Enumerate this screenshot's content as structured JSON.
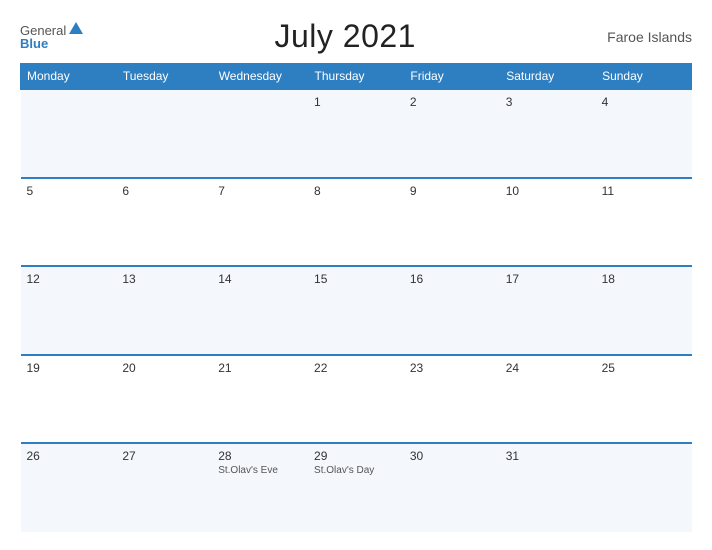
{
  "header": {
    "logo_general": "General",
    "logo_blue": "Blue",
    "title": "July 2021",
    "region": "Faroe Islands"
  },
  "columns": [
    "Monday",
    "Tuesday",
    "Wednesday",
    "Thursday",
    "Friday",
    "Saturday",
    "Sunday"
  ],
  "weeks": [
    [
      {
        "day": "",
        "event": ""
      },
      {
        "day": "",
        "event": ""
      },
      {
        "day": "",
        "event": ""
      },
      {
        "day": "1",
        "event": ""
      },
      {
        "day": "2",
        "event": ""
      },
      {
        "day": "3",
        "event": ""
      },
      {
        "day": "4",
        "event": ""
      }
    ],
    [
      {
        "day": "5",
        "event": ""
      },
      {
        "day": "6",
        "event": ""
      },
      {
        "day": "7",
        "event": ""
      },
      {
        "day": "8",
        "event": ""
      },
      {
        "day": "9",
        "event": ""
      },
      {
        "day": "10",
        "event": ""
      },
      {
        "day": "11",
        "event": ""
      }
    ],
    [
      {
        "day": "12",
        "event": ""
      },
      {
        "day": "13",
        "event": ""
      },
      {
        "day": "14",
        "event": ""
      },
      {
        "day": "15",
        "event": ""
      },
      {
        "day": "16",
        "event": ""
      },
      {
        "day": "17",
        "event": ""
      },
      {
        "day": "18",
        "event": ""
      }
    ],
    [
      {
        "day": "19",
        "event": ""
      },
      {
        "day": "20",
        "event": ""
      },
      {
        "day": "21",
        "event": ""
      },
      {
        "day": "22",
        "event": ""
      },
      {
        "day": "23",
        "event": ""
      },
      {
        "day": "24",
        "event": ""
      },
      {
        "day": "25",
        "event": ""
      }
    ],
    [
      {
        "day": "26",
        "event": ""
      },
      {
        "day": "27",
        "event": ""
      },
      {
        "day": "28",
        "event": "St.Olav's Eve"
      },
      {
        "day": "29",
        "event": "St.Olav's Day"
      },
      {
        "day": "30",
        "event": ""
      },
      {
        "day": "31",
        "event": ""
      },
      {
        "day": "",
        "event": ""
      }
    ]
  ]
}
